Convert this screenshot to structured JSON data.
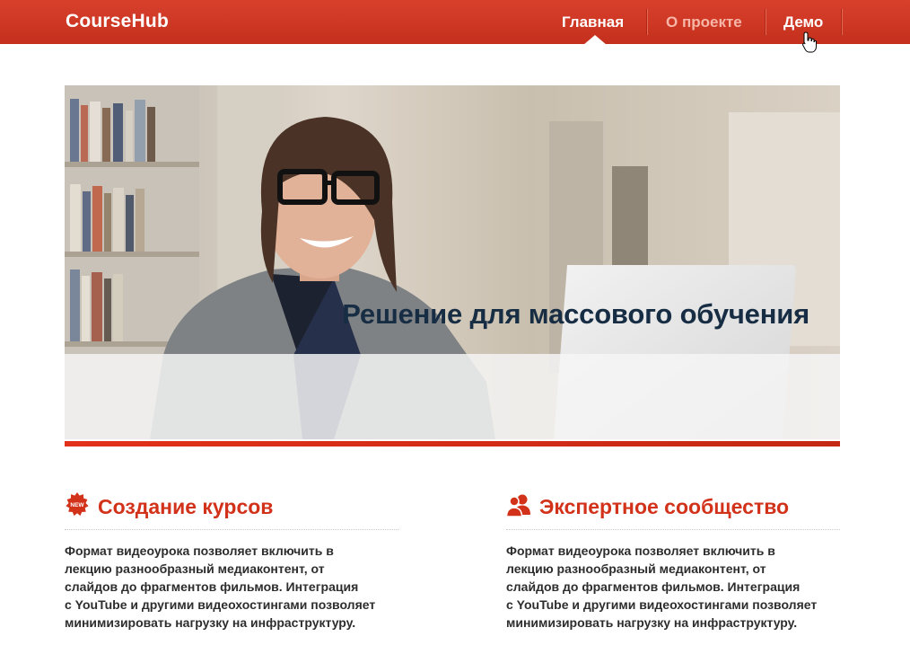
{
  "header": {
    "logo": "CourseHub",
    "nav": [
      {
        "label": "Главная",
        "state": "active"
      },
      {
        "label": "О проекте",
        "state": "inactive"
      },
      {
        "label": "Демо",
        "state": "hover"
      }
    ]
  },
  "hero": {
    "title": "Решение для массового обучения"
  },
  "features": [
    {
      "icon": "new-badge-icon",
      "title": "Создание курсов",
      "lines": [
        "Формат видеоурока позволяет включить в",
        "лекцию разнообразный медиаконтент, от",
        "слайдов до фрагментов фильмов. Интеграция",
        "с YouTube и другими видеохостингами позволяет",
        "минимизировать нагрузку на инфраструктуру."
      ]
    },
    {
      "icon": "users-icon",
      "title": "Экспертное сообщество",
      "lines": [
        "Формат видеоурока позволяет включить в",
        "лекцию разнообразный медиаконтент, от",
        "слайдов до фрагментов фильмов. Интеграция",
        "с YouTube и другими видеохостингами позволяет",
        "минимизировать нагрузку на инфраструктуру."
      ]
    }
  ],
  "icons": {
    "new_badge_text": "NEW"
  },
  "colors": {
    "brand_red": "#d3321a",
    "header_red": "#cf3823",
    "hero_title": "#172d44"
  }
}
